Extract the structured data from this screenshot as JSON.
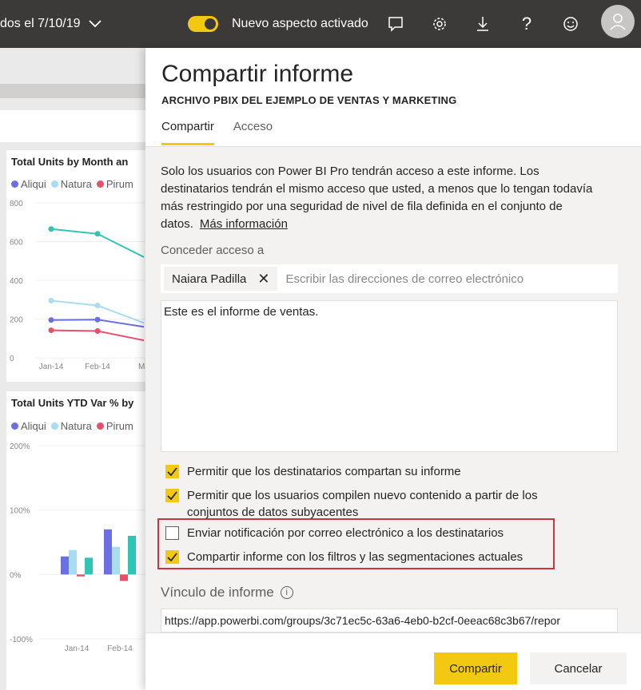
{
  "topbar": {
    "breadcrumb": "dos el 7/10/19",
    "toggle_label": "Nuevo aspecto activado",
    "accent_color": "#f2c811",
    "icons": [
      "comment-icon",
      "gear-icon",
      "download-icon",
      "help-icon",
      "smiley-icon",
      "avatar-icon"
    ]
  },
  "report": {
    "chart1": {
      "title": "Total Units by Month an",
      "legend": [
        "Aliqui",
        "Natura",
        "Pirum"
      ],
      "yticks": [
        "800",
        "600",
        "400",
        "200",
        "0"
      ],
      "xticks": [
        "Jan-14",
        "Feb-14",
        "Ma"
      ]
    },
    "chart2": {
      "title": "Total Units YTD Var % by",
      "legend": [
        "Aliqui",
        "Natura",
        "Pirum"
      ],
      "yticks": [
        "200%",
        "100%",
        "0%",
        "-100%"
      ],
      "xticks": [
        "Jan-14",
        "Feb-14"
      ]
    }
  },
  "chart_data": [
    {
      "type": "line",
      "title": "Total Units by Month an",
      "categories": [
        "Jan-14",
        "Feb-14",
        "Ma"
      ],
      "ylim": [
        0,
        800
      ],
      "series": [
        {
          "name": "Aliqui",
          "color": "#6b6fe3",
          "values": [
            195,
            197,
            160
          ]
        },
        {
          "name": "Natura",
          "color": "#a8dcf0",
          "values": [
            295,
            270,
            180
          ]
        },
        {
          "name": "Pirum",
          "color": "#e8506a",
          "values": [
            142,
            138,
            90
          ]
        },
        {
          "color": "#2ec4b6",
          "values": [
            665,
            640,
            520
          ]
        }
      ]
    },
    {
      "type": "bar",
      "title": "Total Units YTD Var % by",
      "categories": [
        "Jan-14",
        "Feb-14"
      ],
      "ylim": [
        -100,
        200
      ],
      "series": [
        {
          "name": "Aliqui",
          "color": "#6b6fe3",
          "values": [
            28,
            70
          ]
        },
        {
          "name": "Natura",
          "color": "#a8dcf0",
          "values": [
            38,
            43
          ]
        },
        {
          "name": "Pirum",
          "color": "#e8506a",
          "values": [
            -3,
            -10
          ]
        },
        {
          "color": "#2ec4b6",
          "values": [
            26,
            60
          ]
        }
      ]
    }
  ],
  "dialog": {
    "title": "Compartir informe",
    "subtitle": "ARCHIVO PBIX DEL EJEMPLO DE VENTAS Y MARKETING",
    "tabs": [
      "Compartir",
      "Acceso"
    ],
    "description": "Solo los usuarios con Power BI Pro tendrán acceso a este informe. Los destinatarios tendrán el mismo acceso que usted, a menos que lo tengan todavía más restringido por una seguridad de nivel de fila definida en el conjunto de datos.",
    "more_info": "Más información",
    "access_label": "Conceder acceso a",
    "recipient_chip": "Naiara Padilla",
    "email_placeholder": "Escribir las direcciones de correo electrónico",
    "message": "Este es el informe de ventas.",
    "options": [
      {
        "label": "Permitir que los destinatarios compartan su informe",
        "checked": true
      },
      {
        "label": "Permitir que los usuarios compilen nuevo contenido a partir de los conjuntos de datos subyacentes",
        "checked": true
      },
      {
        "label": "Enviar notificación por correo electrónico a los destinatarios",
        "checked": false
      },
      {
        "label": "Compartir informe con los filtros y las segmentaciones actuales",
        "checked": true
      }
    ],
    "link_label": "Vínculo de informe",
    "link_url": "https://app.powerbi.com/groups/3c71ec5c-63a6-4eb0-b2cf-0eeac68c3b67/repor",
    "share_button": "Compartir",
    "cancel_button": "Cancelar",
    "highlight_color": "#d13438"
  }
}
